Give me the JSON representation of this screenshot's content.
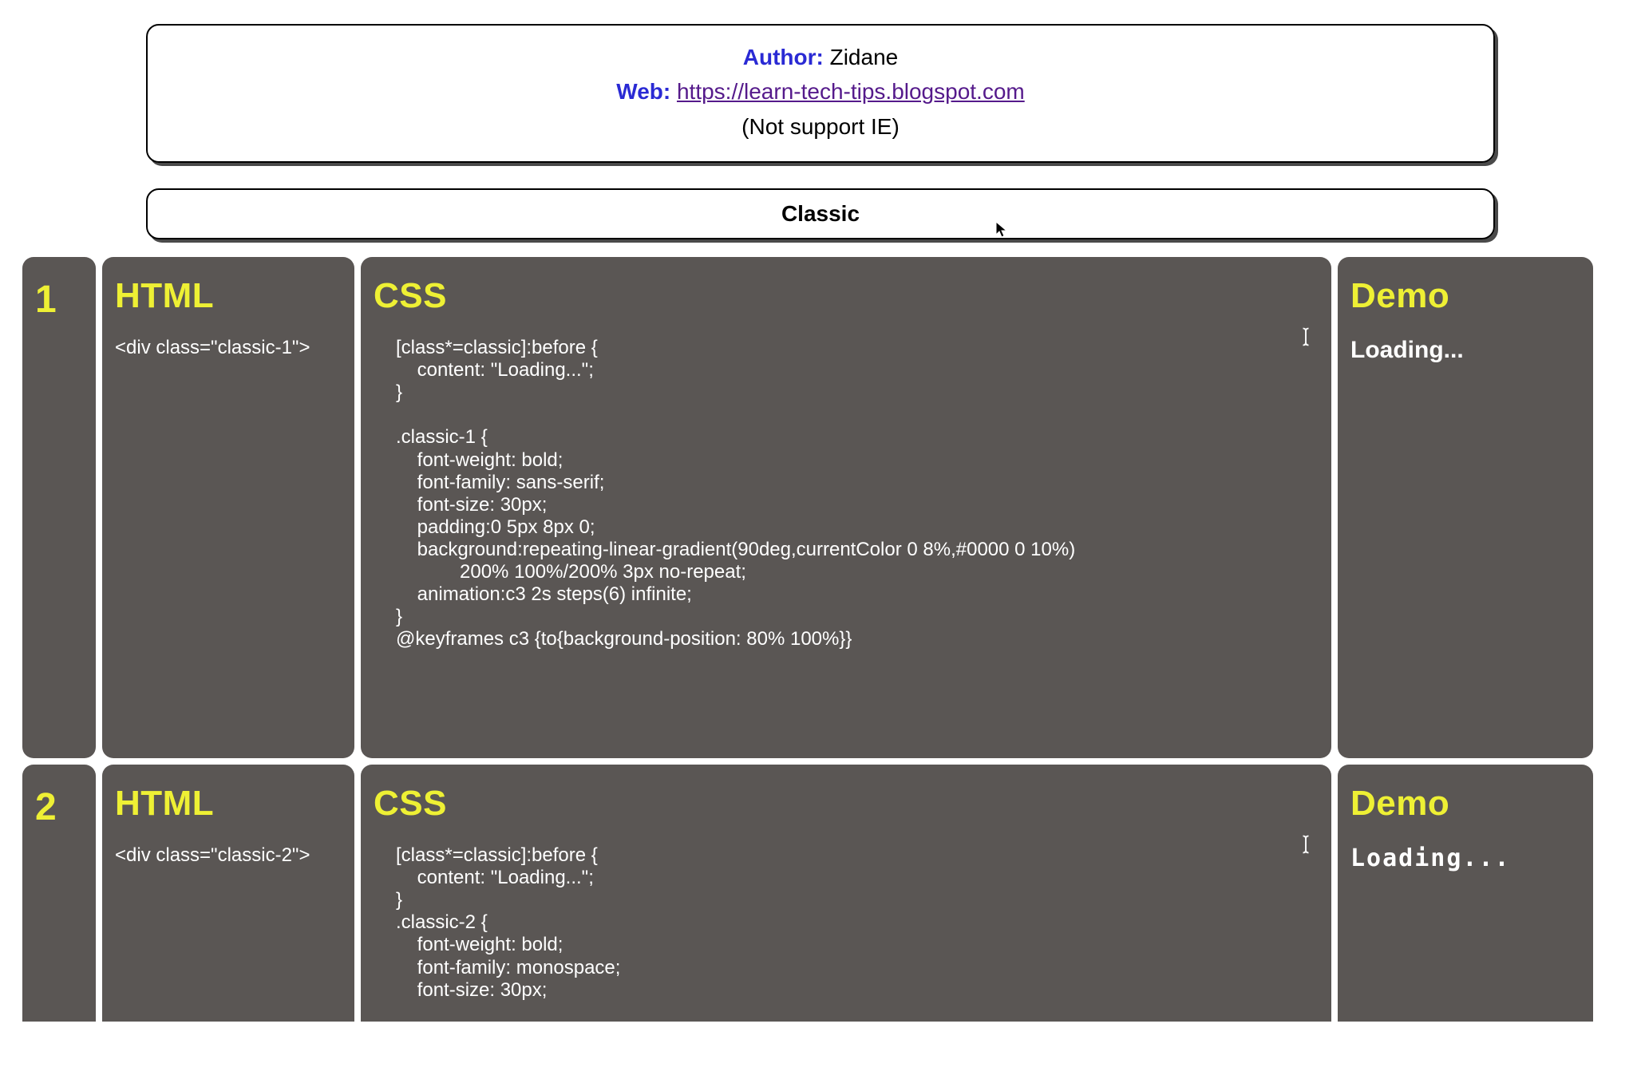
{
  "info": {
    "author_label": "Author:",
    "author_value": " Zidane",
    "web_label": "Web:",
    "web_url_text": "https://learn-tech-tips.blogspot.com",
    "note": "(Not support IE)"
  },
  "section": {
    "title": "Classic"
  },
  "rows": [
    {
      "num": "1",
      "html_header": "HTML",
      "css_header": "CSS",
      "demo_header": "Demo",
      "html_code": "<div class=\"classic-1\">",
      "css_code": "[class*=classic]:before {\n    content: \"Loading...\";\n}\n\n.classic-1 {\n    font-weight: bold;\n    font-family: sans-serif;\n    font-size: 30px;\n    padding:0 5px 8px 0;\n    background:repeating-linear-gradient(90deg,currentColor 0 8%,#0000 0 10%)\n            200% 100%/200% 3px no-repeat;\n    animation:c3 2s steps(6) infinite;\n}\n@keyframes c3 {to{background-position: 80% 100%}}",
      "demo_text": "Loading..."
    },
    {
      "num": "2",
      "html_header": "HTML",
      "css_header": "CSS",
      "demo_header": "Demo",
      "html_code": "<div class=\"classic-2\">",
      "css_code": "[class*=classic]:before {\n    content: \"Loading...\";\n}\n.classic-2 {\n    font-weight: bold;\n    font-family: monospace;\n    font-size: 30px;",
      "demo_text": "Loading..."
    }
  ]
}
